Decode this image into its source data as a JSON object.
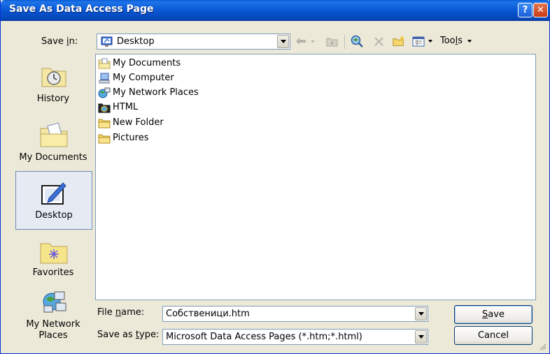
{
  "window": {
    "title": "Save As Data Access Page",
    "help_glyph": "?",
    "close_glyph": "✕"
  },
  "toolbar": {
    "save_in_label_pre": "Save ",
    "save_in_label_u": "i",
    "save_in_label_post": "n:",
    "location": "Desktop",
    "tools_label_pre": "Too",
    "tools_label_u": "l",
    "tools_label_post": "s",
    "icons": [
      "back-icon",
      "up-folder-icon",
      "search-web-icon",
      "delete-icon",
      "new-folder-icon",
      "views-icon"
    ]
  },
  "places": [
    {
      "label": "History",
      "icon": "history-icon"
    },
    {
      "label": "My Documents",
      "icon": "my-documents-icon"
    },
    {
      "label": "Desktop",
      "icon": "desktop-icon",
      "selected": true
    },
    {
      "label": "Favorites",
      "icon": "favorites-icon"
    },
    {
      "label_line1": "My Network",
      "label_line2": "Places",
      "icon": "network-places-icon"
    }
  ],
  "files": [
    {
      "name": "My Documents",
      "icon": "my-documents-icon"
    },
    {
      "name": "My Computer",
      "icon": "my-computer-icon"
    },
    {
      "name": "My Network Places",
      "icon": "network-places-icon"
    },
    {
      "name": "HTML",
      "icon": "html-folder-icon"
    },
    {
      "name": "New Folder",
      "icon": "folder-icon"
    },
    {
      "name": "Pictures",
      "icon": "folder-icon"
    }
  ],
  "form": {
    "filename_label_pre": "File ",
    "filename_label_u": "n",
    "filename_label_post": "ame:",
    "filename_value": "Собственици.htm",
    "type_label_pre": "Save as ",
    "type_label_u": "t",
    "type_label_post": "ype:",
    "type_value": "Microsoft Data Access Pages (*.htm;*.html)"
  },
  "buttons": {
    "save_u": "S",
    "save_rest": "ave",
    "cancel": "Cancel"
  }
}
